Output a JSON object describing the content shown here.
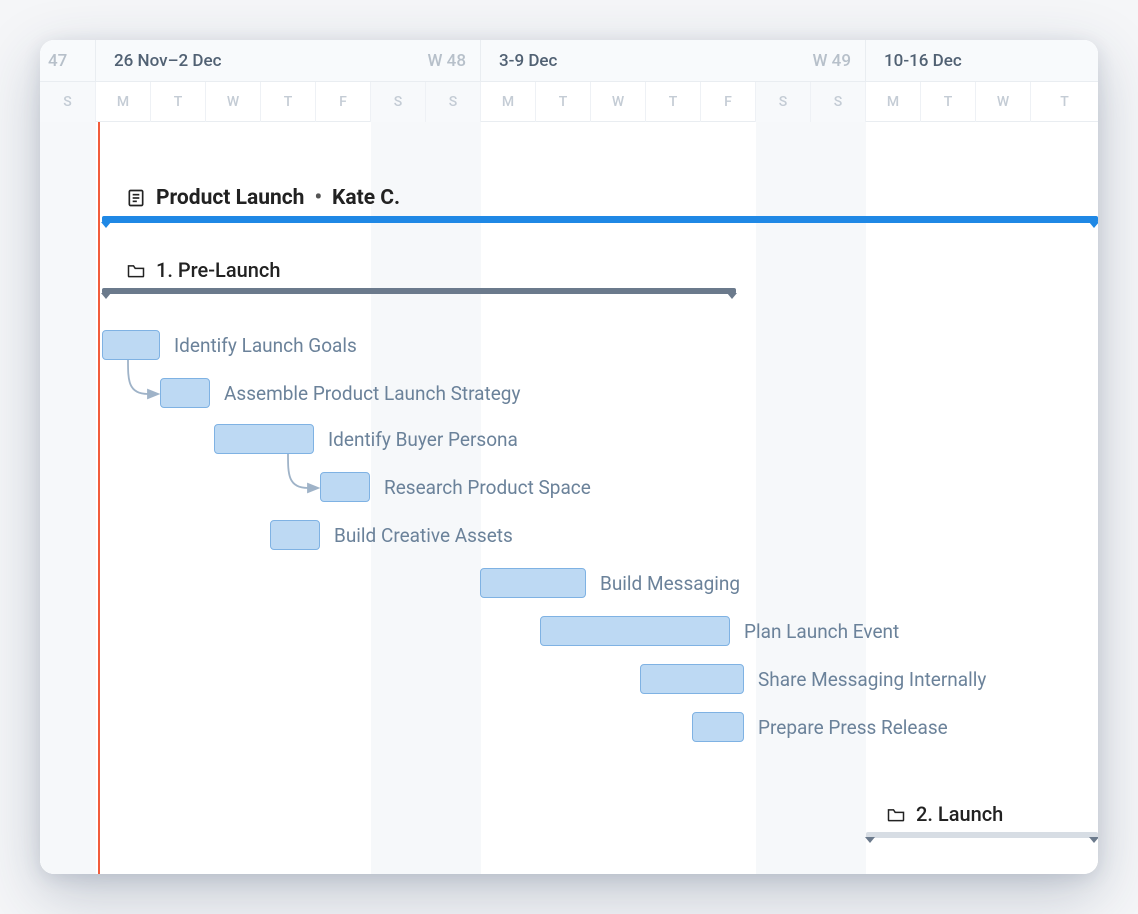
{
  "timeline": {
    "prev_week_suffix": "47",
    "weeks": [
      {
        "label": "26 Nov–2 Dec",
        "wnum": "W 48"
      },
      {
        "label": "3-9 Dec",
        "wnum": "W 49"
      },
      {
        "label": "10-16 Dec",
        "wnum": ""
      }
    ],
    "days": [
      "S",
      "M",
      "T",
      "W",
      "T",
      "F",
      "S",
      "S",
      "M",
      "T",
      "W",
      "T",
      "F",
      "S",
      "S",
      "M",
      "T",
      "W",
      "T"
    ],
    "weekend_indices": [
      0,
      6,
      7,
      13,
      14
    ]
  },
  "project": {
    "title": "Product Launch",
    "owner": "Kate C."
  },
  "folders": [
    {
      "title": "1. Pre-Launch"
    },
    {
      "title": "2. Launch"
    }
  ],
  "tasks": [
    {
      "label": "Identify Launch Goals"
    },
    {
      "label": "Assemble Product Launch Strategy"
    },
    {
      "label": "Identify Buyer Persona"
    },
    {
      "label": "Research Product Space"
    },
    {
      "label": "Build Creative Assets"
    },
    {
      "label": "Build Messaging"
    },
    {
      "label": "Plan Launch Event"
    },
    {
      "label": "Share Messaging Internally"
    },
    {
      "label": "Prepare Press Release"
    }
  ],
  "colors": {
    "accent": "#1f88e5",
    "folder_bar": "#6b7a8c",
    "task_fill": "#bdd9f3",
    "task_border": "#7fb2e3",
    "today_line": "#f25c3b"
  }
}
